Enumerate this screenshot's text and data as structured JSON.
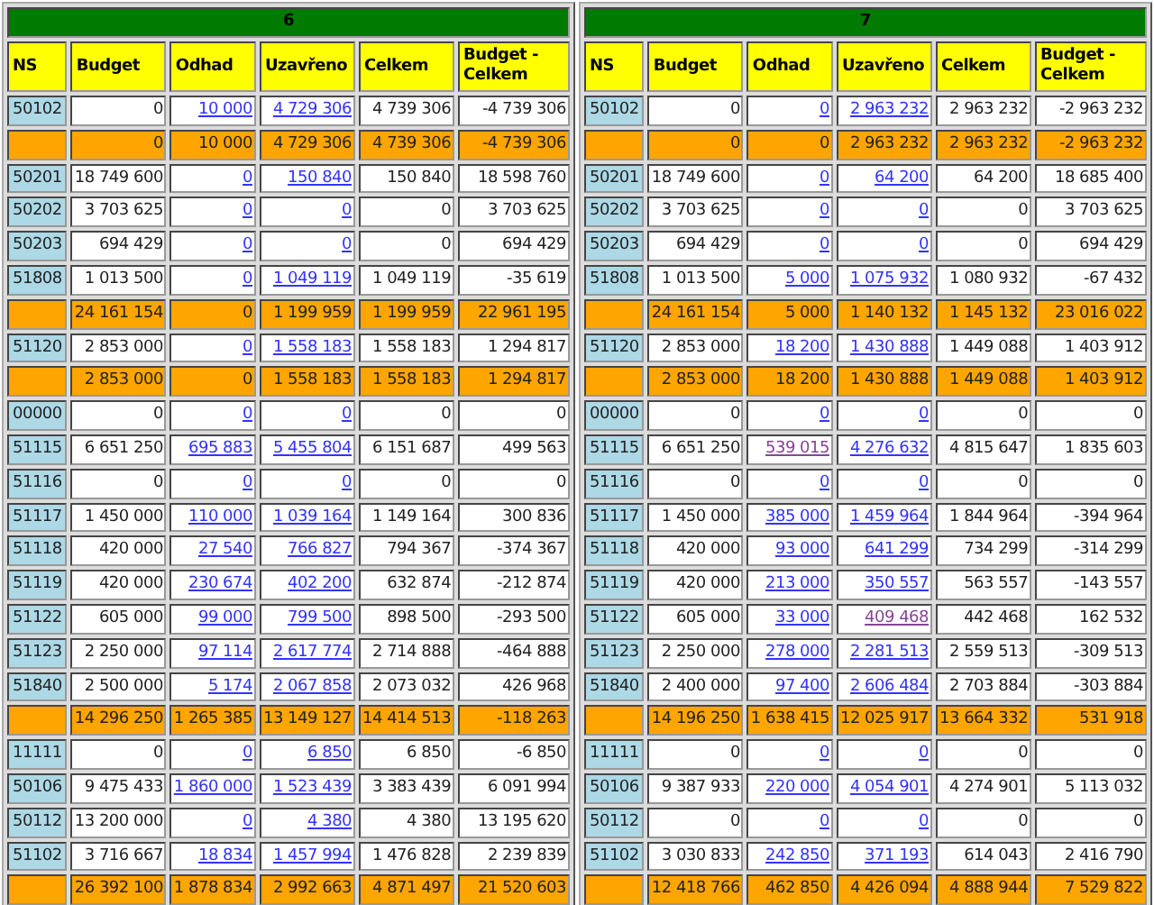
{
  "panels": [
    {
      "title": "6",
      "columns": [
        "NS",
        "Budget",
        "Odhad",
        "Uzavřeno",
        "Celkem",
        "Budget - Celkem"
      ],
      "rows": [
        {
          "kind": "item",
          "ns": "50102",
          "budget": "0",
          "odhad": {
            "text": "10 000",
            "visited": false
          },
          "uzavreno": {
            "text": "4 729 306",
            "visited": false
          },
          "celkem": "4 739 306",
          "difference": "-4 739 306"
        },
        {
          "kind": "subtotal",
          "budget": "0",
          "odhad": "10 000",
          "uzavreno": "4 729 306",
          "celkem": "4 739 306",
          "difference": "-4 739 306"
        },
        {
          "kind": "item",
          "ns": "50201",
          "budget": "18 749 600",
          "odhad": {
            "text": "0",
            "visited": false
          },
          "uzavreno": {
            "text": "150 840",
            "visited": false
          },
          "celkem": "150 840",
          "difference": "18 598 760"
        },
        {
          "kind": "item",
          "ns": "50202",
          "budget": "3 703 625",
          "odhad": {
            "text": "0",
            "visited": false
          },
          "uzavreno": {
            "text": "0",
            "visited": false
          },
          "celkem": "0",
          "difference": "3 703 625"
        },
        {
          "kind": "item",
          "ns": "50203",
          "budget": "694 429",
          "odhad": {
            "text": "0",
            "visited": false
          },
          "uzavreno": {
            "text": "0",
            "visited": false
          },
          "celkem": "0",
          "difference": "694 429"
        },
        {
          "kind": "item",
          "ns": "51808",
          "budget": "1 013 500",
          "odhad": {
            "text": "0",
            "visited": false
          },
          "uzavreno": {
            "text": "1 049 119",
            "visited": false
          },
          "celkem": "1 049 119",
          "difference": "-35 619"
        },
        {
          "kind": "subtotal",
          "budget": "24 161 154",
          "odhad": "0",
          "uzavreno": "1 199 959",
          "celkem": "1 199 959",
          "difference": "22 961 195"
        },
        {
          "kind": "item",
          "ns": "51120",
          "budget": "2 853 000",
          "odhad": {
            "text": "0",
            "visited": false
          },
          "uzavreno": {
            "text": "1 558 183",
            "visited": false
          },
          "celkem": "1 558 183",
          "difference": "1 294 817"
        },
        {
          "kind": "subtotal",
          "budget": "2 853 000",
          "odhad": "0",
          "uzavreno": "1 558 183",
          "celkem": "1 558 183",
          "difference": "1 294 817"
        },
        {
          "kind": "item",
          "ns": "00000",
          "budget": "0",
          "odhad": {
            "text": "0",
            "visited": false
          },
          "uzavreno": {
            "text": "0",
            "visited": false
          },
          "celkem": "0",
          "difference": "0"
        },
        {
          "kind": "item",
          "ns": "51115",
          "budget": "6 651 250",
          "odhad": {
            "text": "695 883",
            "visited": false
          },
          "uzavreno": {
            "text": "5 455 804",
            "visited": false
          },
          "celkem": "6 151 687",
          "difference": "499 563"
        },
        {
          "kind": "item",
          "ns": "51116",
          "budget": "0",
          "odhad": {
            "text": "0",
            "visited": false
          },
          "uzavreno": {
            "text": "0",
            "visited": false
          },
          "celkem": "0",
          "difference": "0"
        },
        {
          "kind": "item",
          "ns": "51117",
          "budget": "1 450 000",
          "odhad": {
            "text": "110 000",
            "visited": false
          },
          "uzavreno": {
            "text": "1 039 164",
            "visited": false
          },
          "celkem": "1 149 164",
          "difference": "300 836"
        },
        {
          "kind": "item",
          "ns": "51118",
          "budget": "420 000",
          "odhad": {
            "text": "27 540",
            "visited": false
          },
          "uzavreno": {
            "text": "766 827",
            "visited": false
          },
          "celkem": "794 367",
          "difference": "-374 367"
        },
        {
          "kind": "item",
          "ns": "51119",
          "budget": "420 000",
          "odhad": {
            "text": "230 674",
            "visited": false
          },
          "uzavreno": {
            "text": "402 200",
            "visited": false
          },
          "celkem": "632 874",
          "difference": "-212 874"
        },
        {
          "kind": "item",
          "ns": "51122",
          "budget": "605 000",
          "odhad": {
            "text": "99 000",
            "visited": false
          },
          "uzavreno": {
            "text": "799 500",
            "visited": false
          },
          "celkem": "898 500",
          "difference": "-293 500"
        },
        {
          "kind": "item",
          "ns": "51123",
          "budget": "2 250 000",
          "odhad": {
            "text": "97 114",
            "visited": false
          },
          "uzavreno": {
            "text": "2 617 774",
            "visited": false
          },
          "celkem": "2 714 888",
          "difference": "-464 888"
        },
        {
          "kind": "item",
          "ns": "51840",
          "budget": "2 500 000",
          "odhad": {
            "text": "5 174",
            "visited": false
          },
          "uzavreno": {
            "text": "2 067 858",
            "visited": false
          },
          "celkem": "2 073 032",
          "difference": "426 968"
        },
        {
          "kind": "subtotal",
          "budget": "14 296 250",
          "odhad": "1 265 385",
          "uzavreno": "13 149 127",
          "celkem": "14 414 513",
          "difference": "-118 263"
        },
        {
          "kind": "item",
          "ns": "11111",
          "budget": "0",
          "odhad": {
            "text": "0",
            "visited": false
          },
          "uzavreno": {
            "text": "6 850",
            "visited": false
          },
          "celkem": "6 850",
          "difference": "-6 850"
        },
        {
          "kind": "item",
          "ns": "50106",
          "budget": "9 475 433",
          "odhad": {
            "text": "1 860 000",
            "visited": false
          },
          "uzavreno": {
            "text": "1 523 439",
            "visited": false
          },
          "celkem": "3 383 439",
          "difference": "6 091 994"
        },
        {
          "kind": "item",
          "ns": "50112",
          "budget": "13 200 000",
          "odhad": {
            "text": "0",
            "visited": false
          },
          "uzavreno": {
            "text": "4 380",
            "visited": false
          },
          "celkem": "4 380",
          "difference": "13 195 620"
        },
        {
          "kind": "item",
          "ns": "51102",
          "budget": "3 716 667",
          "odhad": {
            "text": "18 834",
            "visited": false
          },
          "uzavreno": {
            "text": "1 457 994",
            "visited": false
          },
          "celkem": "1 476 828",
          "difference": "2 239 839"
        },
        {
          "kind": "subtotal",
          "budget": "26 392 100",
          "odhad": "1 878 834",
          "uzavreno": "2 992 663",
          "celkem": "4 871 497",
          "difference": "21 520 603"
        }
      ]
    },
    {
      "title": "7",
      "columns": [
        "NS",
        "Budget",
        "Odhad",
        "Uzavřeno",
        "Celkem",
        "Budget - Celkem"
      ],
      "rows": [
        {
          "kind": "item",
          "ns": "50102",
          "budget": "0",
          "odhad": {
            "text": "0",
            "visited": false
          },
          "uzavreno": {
            "text": "2 963 232",
            "visited": false
          },
          "celkem": "2 963 232",
          "difference": "-2 963 232"
        },
        {
          "kind": "subtotal",
          "budget": "0",
          "odhad": "0",
          "uzavreno": "2 963 232",
          "celkem": "2 963 232",
          "difference": "-2 963 232"
        },
        {
          "kind": "item",
          "ns": "50201",
          "budget": "18 749 600",
          "odhad": {
            "text": "0",
            "visited": false
          },
          "uzavreno": {
            "text": "64 200",
            "visited": false
          },
          "celkem": "64 200",
          "difference": "18 685 400"
        },
        {
          "kind": "item",
          "ns": "50202",
          "budget": "3 703 625",
          "odhad": {
            "text": "0",
            "visited": false
          },
          "uzavreno": {
            "text": "0",
            "visited": false
          },
          "celkem": "0",
          "difference": "3 703 625"
        },
        {
          "kind": "item",
          "ns": "50203",
          "budget": "694 429",
          "odhad": {
            "text": "0",
            "visited": false
          },
          "uzavreno": {
            "text": "0",
            "visited": false
          },
          "celkem": "0",
          "difference": "694 429"
        },
        {
          "kind": "item",
          "ns": "51808",
          "budget": "1 013 500",
          "odhad": {
            "text": "5 000",
            "visited": false
          },
          "uzavreno": {
            "text": "1 075 932",
            "visited": false
          },
          "celkem": "1 080 932",
          "difference": "-67 432"
        },
        {
          "kind": "subtotal",
          "budget": "24 161 154",
          "odhad": "5 000",
          "uzavreno": "1 140 132",
          "celkem": "1 145 132",
          "difference": "23 016 022"
        },
        {
          "kind": "item",
          "ns": "51120",
          "budget": "2 853 000",
          "odhad": {
            "text": "18 200",
            "visited": false
          },
          "uzavreno": {
            "text": "1 430 888",
            "visited": false
          },
          "celkem": "1 449 088",
          "difference": "1 403 912"
        },
        {
          "kind": "subtotal",
          "budget": "2 853 000",
          "odhad": "18 200",
          "uzavreno": "1 430 888",
          "celkem": "1 449 088",
          "difference": "1 403 912"
        },
        {
          "kind": "item",
          "ns": "00000",
          "budget": "0",
          "odhad": {
            "text": "0",
            "visited": false
          },
          "uzavreno": {
            "text": "0",
            "visited": false
          },
          "celkem": "0",
          "difference": "0"
        },
        {
          "kind": "item",
          "ns": "51115",
          "budget": "6 651 250",
          "odhad": {
            "text": "539 015",
            "visited": true
          },
          "uzavreno": {
            "text": "4 276 632",
            "visited": false
          },
          "celkem": "4 815 647",
          "difference": "1 835 603"
        },
        {
          "kind": "item",
          "ns": "51116",
          "budget": "0",
          "odhad": {
            "text": "0",
            "visited": false
          },
          "uzavreno": {
            "text": "0",
            "visited": false
          },
          "celkem": "0",
          "difference": "0"
        },
        {
          "kind": "item",
          "ns": "51117",
          "budget": "1 450 000",
          "odhad": {
            "text": "385 000",
            "visited": false
          },
          "uzavreno": {
            "text": "1 459 964",
            "visited": false
          },
          "celkem": "1 844 964",
          "difference": "-394 964"
        },
        {
          "kind": "item",
          "ns": "51118",
          "budget": "420 000",
          "odhad": {
            "text": "93 000",
            "visited": false
          },
          "uzavreno": {
            "text": "641 299",
            "visited": false
          },
          "celkem": "734 299",
          "difference": "-314 299"
        },
        {
          "kind": "item",
          "ns": "51119",
          "budget": "420 000",
          "odhad": {
            "text": "213 000",
            "visited": false
          },
          "uzavreno": {
            "text": "350 557",
            "visited": false
          },
          "celkem": "563 557",
          "difference": "-143 557"
        },
        {
          "kind": "item",
          "ns": "51122",
          "budget": "605 000",
          "odhad": {
            "text": "33 000",
            "visited": false
          },
          "uzavreno": {
            "text": "409 468",
            "visited": true
          },
          "celkem": "442 468",
          "difference": "162 532"
        },
        {
          "kind": "item",
          "ns": "51123",
          "budget": "2 250 000",
          "odhad": {
            "text": "278 000",
            "visited": false
          },
          "uzavreno": {
            "text": "2 281 513",
            "visited": false
          },
          "celkem": "2 559 513",
          "difference": "-309 513"
        },
        {
          "kind": "item",
          "ns": "51840",
          "budget": "2 400 000",
          "odhad": {
            "text": "97 400",
            "visited": false
          },
          "uzavreno": {
            "text": "2 606 484",
            "visited": false
          },
          "celkem": "2 703 884",
          "difference": "-303 884"
        },
        {
          "kind": "subtotal",
          "budget": "14 196 250",
          "odhad": "1 638 415",
          "uzavreno": "12 025 917",
          "celkem": "13 664 332",
          "difference": "531 918"
        },
        {
          "kind": "item",
          "ns": "11111",
          "budget": "0",
          "odhad": {
            "text": "0",
            "visited": false
          },
          "uzavreno": {
            "text": "0",
            "visited": false
          },
          "celkem": "0",
          "difference": "0"
        },
        {
          "kind": "item",
          "ns": "50106",
          "budget": "9 387 933",
          "odhad": {
            "text": "220 000",
            "visited": false
          },
          "uzavreno": {
            "text": "4 054 901",
            "visited": false
          },
          "celkem": "4 274 901",
          "difference": "5 113 032"
        },
        {
          "kind": "item",
          "ns": "50112",
          "budget": "0",
          "odhad": {
            "text": "0",
            "visited": false
          },
          "uzavreno": {
            "text": "0",
            "visited": false
          },
          "celkem": "0",
          "difference": "0"
        },
        {
          "kind": "item",
          "ns": "51102",
          "budget": "3 030 833",
          "odhad": {
            "text": "242 850",
            "visited": false
          },
          "uzavreno": {
            "text": "371 193",
            "visited": false
          },
          "celkem": "614 043",
          "difference": "2 416 790"
        },
        {
          "kind": "subtotal",
          "budget": "12 418 766",
          "odhad": "462 850",
          "uzavreno": "4 426 094",
          "celkem": "4 888 944",
          "difference": "7 529 822"
        }
      ]
    }
  ]
}
